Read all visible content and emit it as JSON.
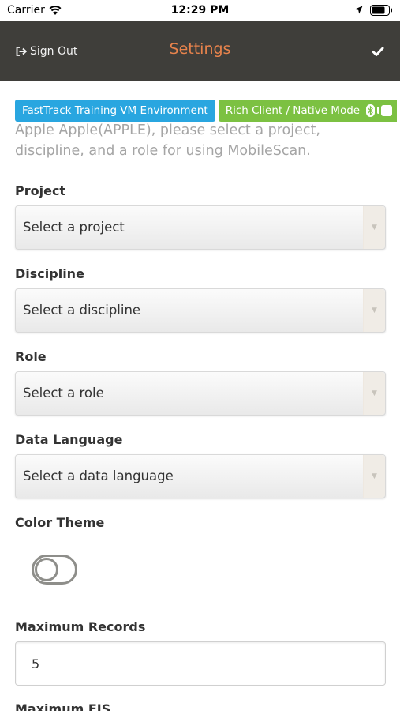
{
  "status": {
    "carrier": "Carrier",
    "time": "12:29 PM"
  },
  "nav": {
    "signout_label": "Sign Out",
    "title": "Settings"
  },
  "badges": {
    "environment": "FastTrack Training VM Environment",
    "mode": "Rich Client / Native Mode"
  },
  "intro": "Apple Apple(APPLE), please select a project, discipline, and a role for using MobileScan.",
  "fields": {
    "project": {
      "label": "Project",
      "value": "Select a project"
    },
    "discipline": {
      "label": "Discipline",
      "value": "Select a discipline"
    },
    "role": {
      "label": "Role",
      "value": "Select a role"
    },
    "data_language": {
      "label": "Data Language",
      "value": "Select a data language"
    },
    "color_theme": {
      "label": "Color Theme"
    },
    "maximum_records": {
      "label": "Maximum Records",
      "value": "5"
    },
    "maximum_fis": {
      "label": "Maximum FIS"
    }
  },
  "colors": {
    "nav_bg": "#3f3e3a",
    "title_accent": "#e8834c",
    "badge_env": "#29a6e0",
    "badge_mode": "#7cc142"
  },
  "icons": [
    "wifi-icon",
    "location-arrow-icon",
    "battery-icon",
    "sign-out-icon",
    "checkmark-icon",
    "bluetooth-icon",
    "android-icon",
    "dropdown-arrow-icon"
  ]
}
